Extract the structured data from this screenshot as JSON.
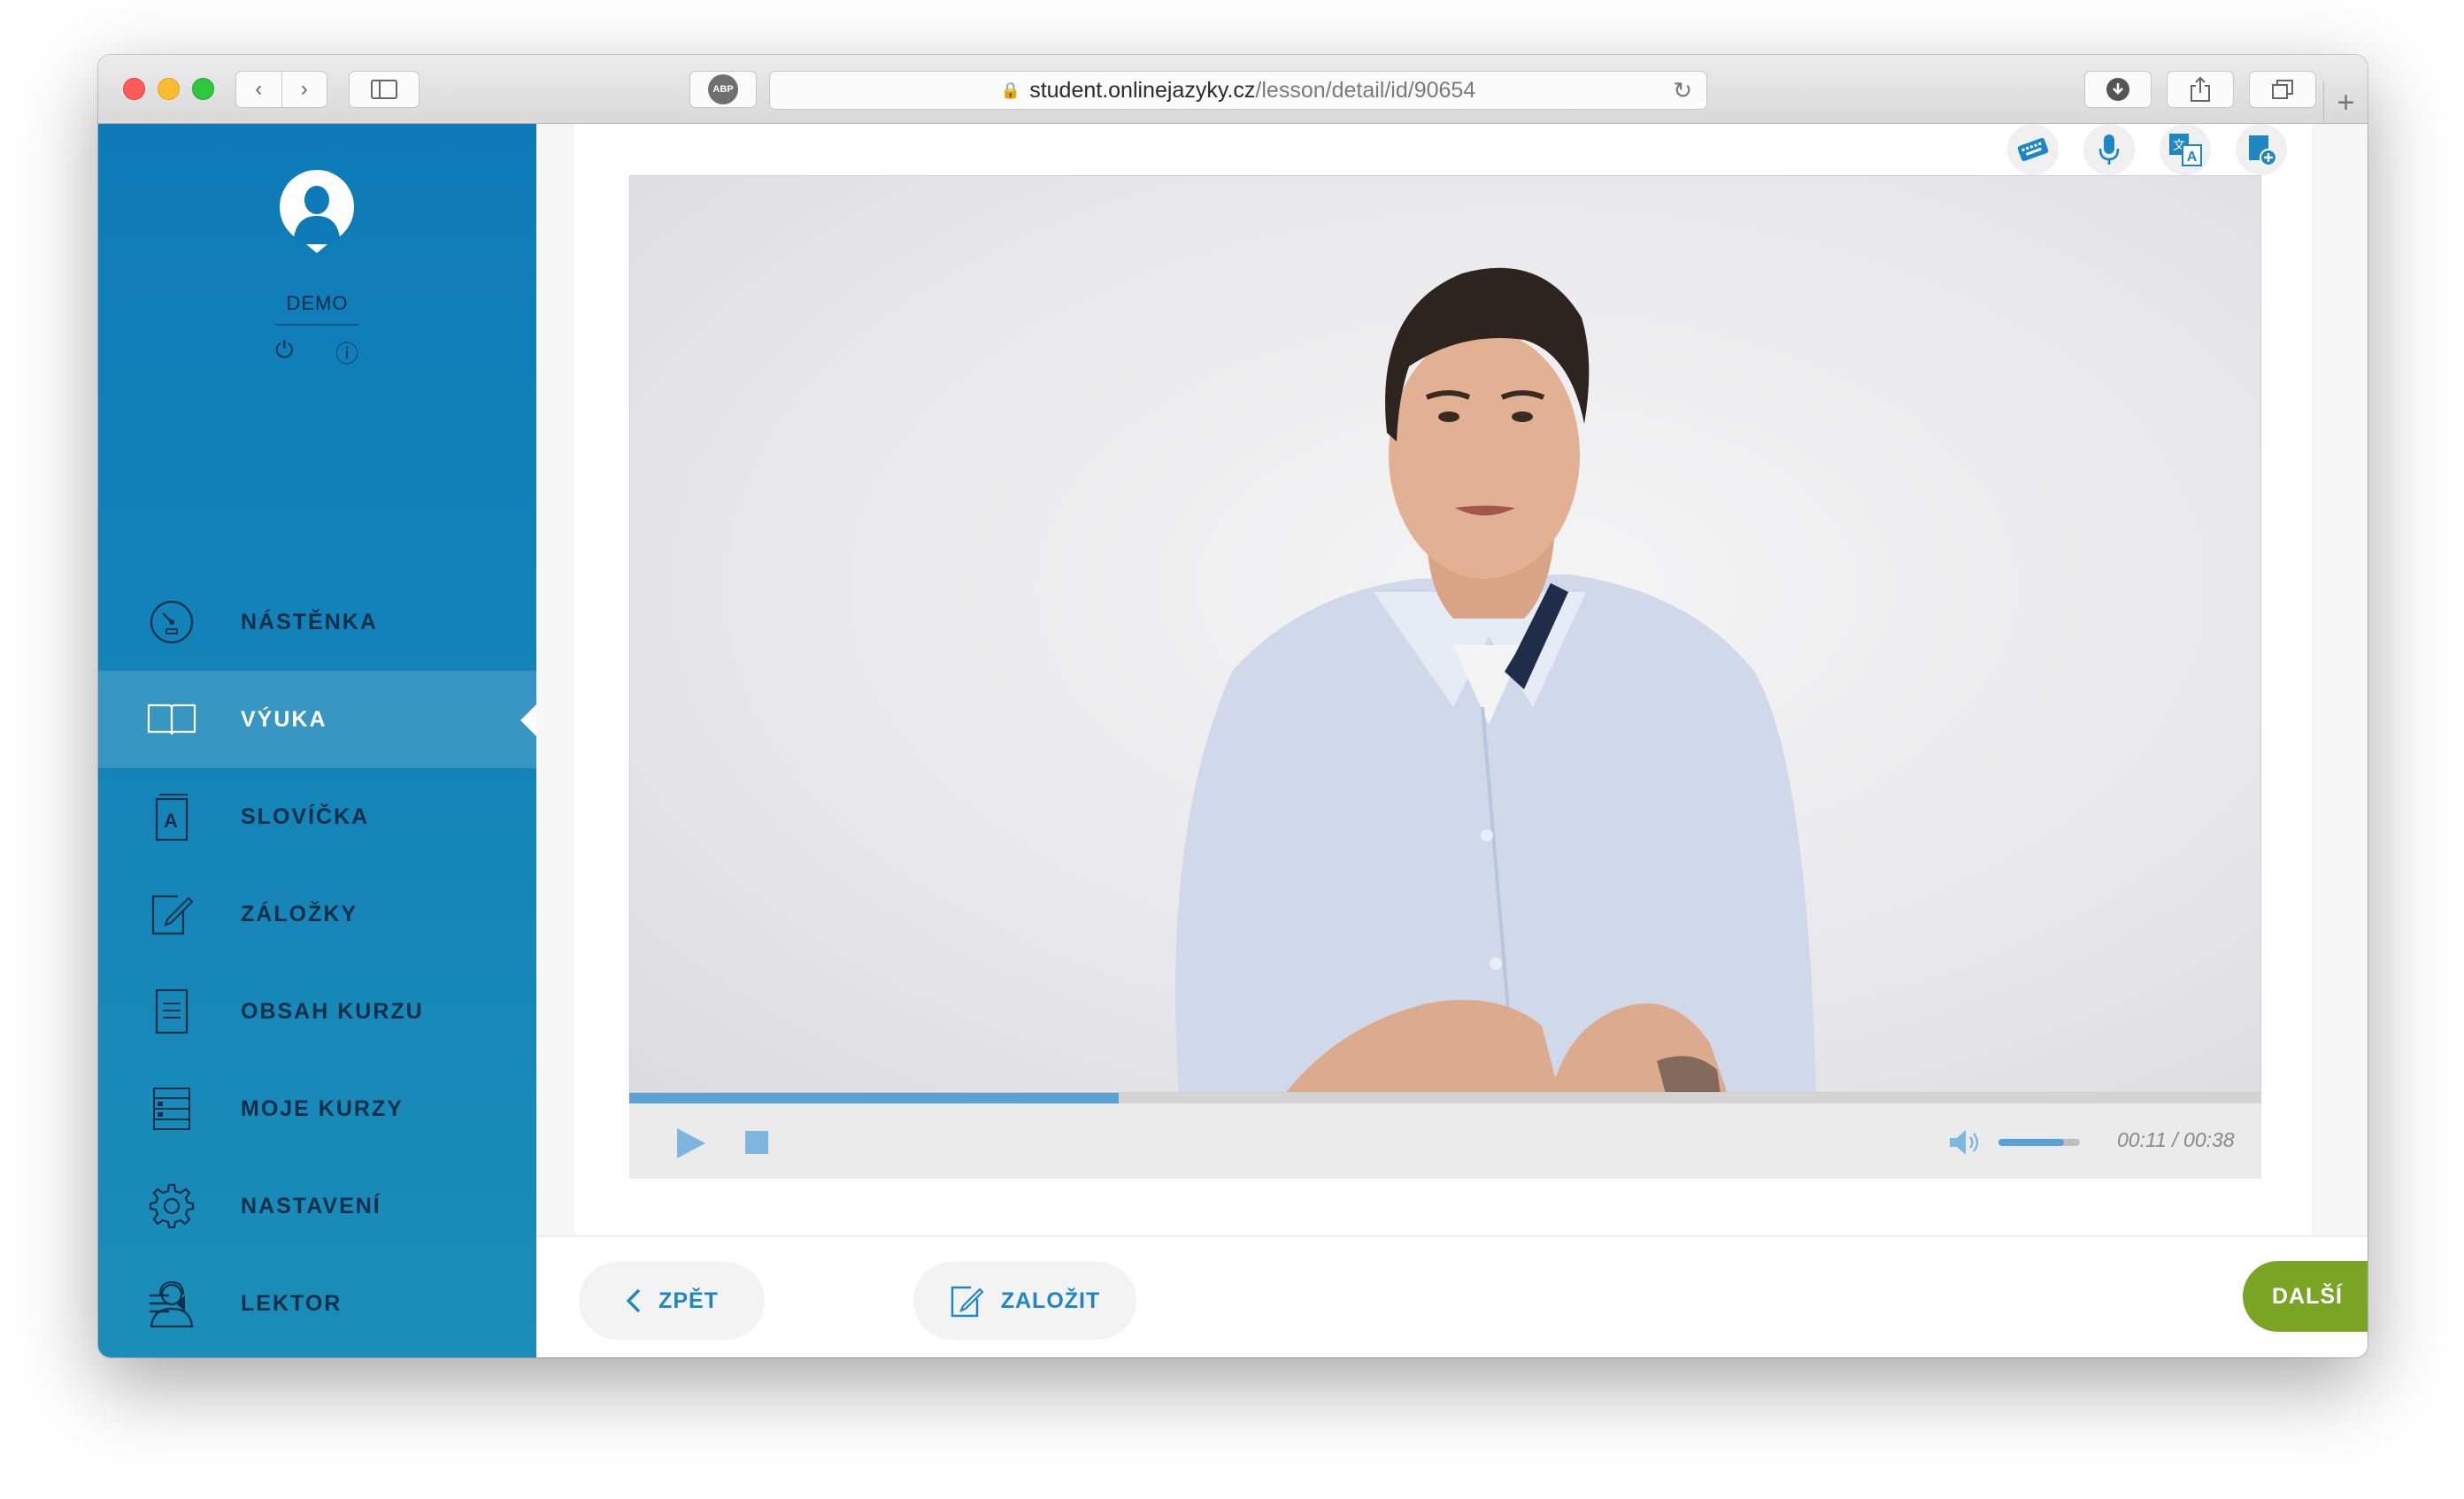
{
  "browser": {
    "url_host": "student.onlinejazyky.cz",
    "url_path": "/lesson/detail/id/90654",
    "adblock_label": "ABP"
  },
  "user": {
    "name": "DEMO"
  },
  "nav": {
    "items": [
      {
        "label": "NÁSTĚNKA",
        "icon": "dashboard-gauge-icon"
      },
      {
        "label": "VÝUKA",
        "icon": "open-book-icon",
        "active": true
      },
      {
        "label": "SLOVÍČKA",
        "icon": "vocabulary-card-icon"
      },
      {
        "label": "ZÁLOŽKY",
        "icon": "bookmark-edit-icon"
      },
      {
        "label": "OBSAH KURZU",
        "icon": "document-list-icon"
      },
      {
        "label": "MOJE KURZY",
        "icon": "course-list-icon"
      },
      {
        "label": "NASTAVENÍ",
        "icon": "gear-icon"
      },
      {
        "label": "LEKTOR",
        "icon": "tutor-person-icon"
      }
    ]
  },
  "toolbar_icons": [
    "keyboard-icon",
    "microphone-icon",
    "translate-icon",
    "add-document-icon"
  ],
  "player": {
    "current_time": "00:11",
    "separator": "/",
    "duration": "00:38",
    "progress_fraction": 0.3,
    "volume_fraction": 0.8
  },
  "actions": {
    "back_label": "ZPĚT",
    "bookmark_label": "ZALOŽIT",
    "next_label": "DALŠÍ"
  },
  "colors": {
    "sidebar": "#0e7bb8",
    "accent_blue": "#1f86c4",
    "next_green": "#7aa424",
    "progress": "#5aa2d6"
  }
}
